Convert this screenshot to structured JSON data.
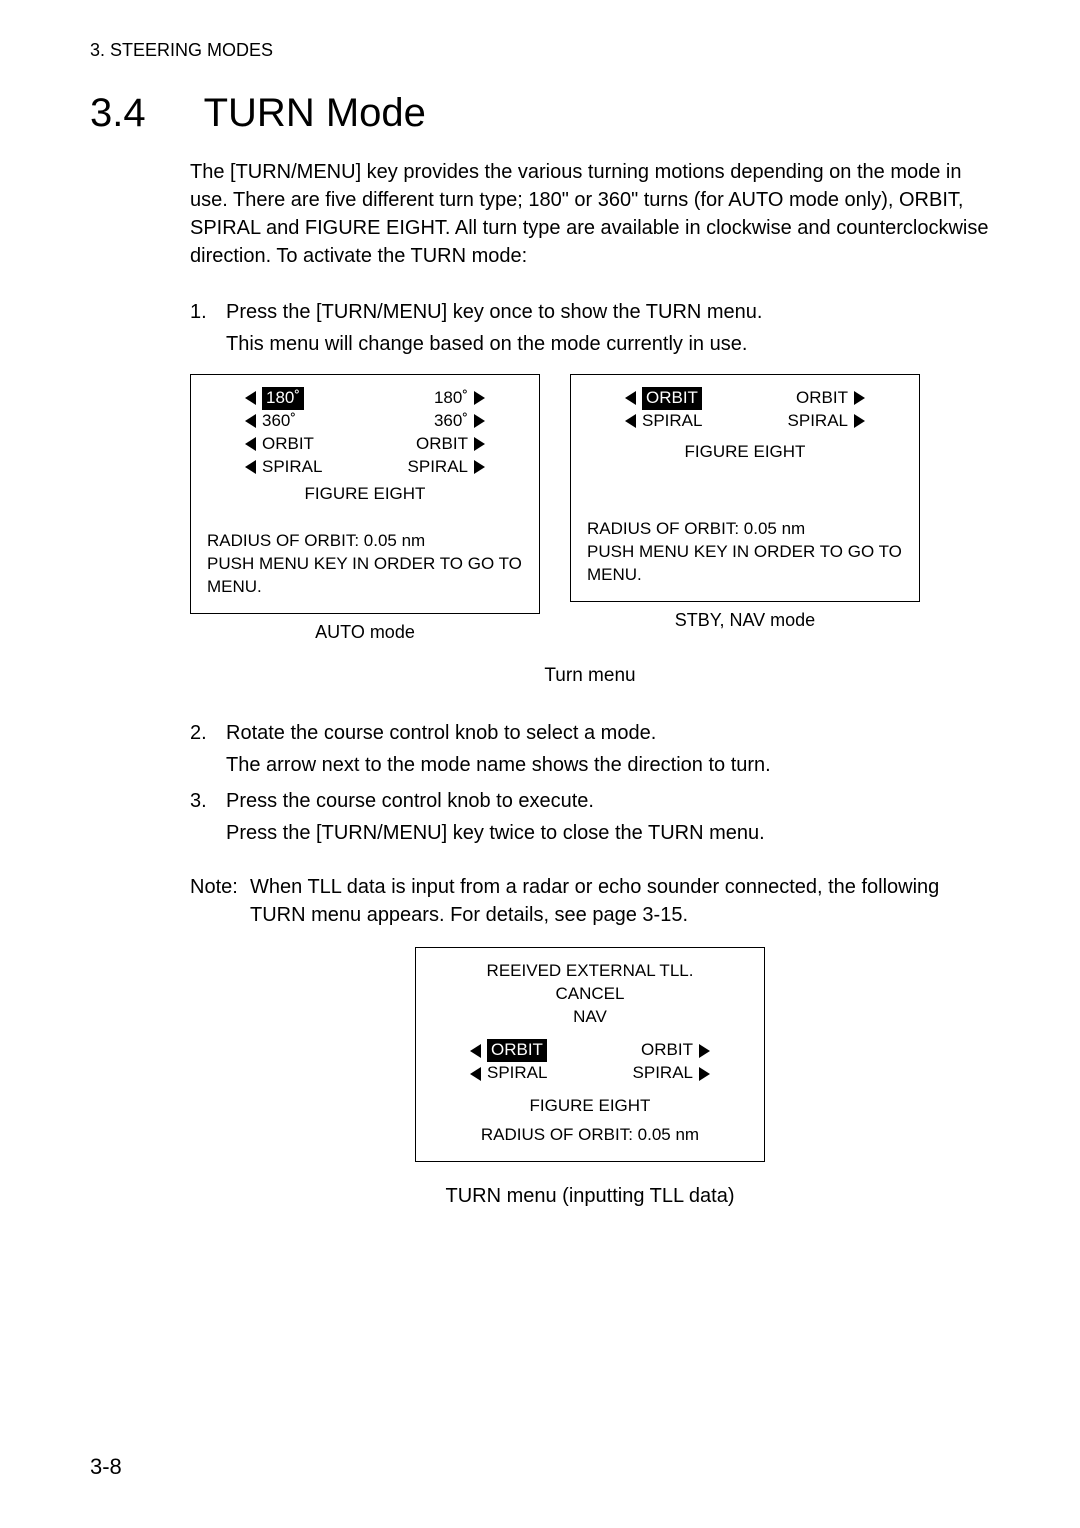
{
  "header": {
    "running_head": "3. STEERING MODES"
  },
  "section": {
    "number": "3.4",
    "title": "TURN Mode"
  },
  "intro": "The [TURN/MENU] key provides the various turning motions depending on the mode in use. There are five different turn type; 180\" or 360\" turns (for AUTO mode only), ORBIT, SPIRAL and FIGURE EIGHT. All turn type are available in clockwise and counterclockwise direction. To activate the TURN mode:",
  "steps": [
    {
      "n": "1.",
      "text": "Press the [TURN/MENU] key once to show the TURN menu.",
      "sub": "This menu will change based on the mode currently in use."
    },
    {
      "n": "2.",
      "text": "Rotate the course control knob to select a mode.",
      "sub": "The arrow next to the mode name shows the direction to turn."
    },
    {
      "n": "3.",
      "text": "Press the course control knob to execute.",
      "sub": "Press the [TURN/MENU] key twice to close the TURN menu."
    }
  ],
  "auto_panel": {
    "caption": "AUTO mode",
    "rows": [
      {
        "l": "180˚",
        "l_sel": true,
        "r": "180˚"
      },
      {
        "l": "360˚",
        "r": "360˚"
      },
      {
        "l": "ORBIT",
        "r": "ORBIT"
      },
      {
        "l": "SPIRAL",
        "r": "SPIRAL"
      }
    ],
    "center": "FIGURE EIGHT",
    "footer1": "RADIUS OF ORBIT: 0.05 nm",
    "footer2": "PUSH MENU KEY IN ORDER TO GO TO MENU."
  },
  "stby_panel": {
    "caption": "STBY, NAV mode",
    "rows": [
      {
        "l": "ORBIT",
        "l_sel": true,
        "r": "ORBIT"
      },
      {
        "l": "SPIRAL",
        "r": "SPIRAL"
      }
    ],
    "center": "FIGURE EIGHT",
    "footer1": "RADIUS OF ORBIT: 0.05 nm",
    "footer2": "PUSH MENU KEY IN ORDER TO GO TO MENU."
  },
  "turn_menu_caption": "Turn menu",
  "note": {
    "label": "Note:",
    "text": "When TLL data is input from a radar or echo sounder connected, the following TURN menu appears. For details, see page 3-15."
  },
  "tll_panel": {
    "head1": "REEIVED EXTERNAL TLL.",
    "head2": "CANCEL",
    "head3": "NAV",
    "rows": [
      {
        "l": "ORBIT",
        "l_sel": true,
        "r": "ORBIT"
      },
      {
        "l": "SPIRAL",
        "r": "SPIRAL"
      }
    ],
    "center": "FIGURE EIGHT",
    "footer": "RADIUS OF ORBIT: 0.05 nm",
    "caption": "TURN menu (inputting TLL data)"
  },
  "page_number": "3-8"
}
